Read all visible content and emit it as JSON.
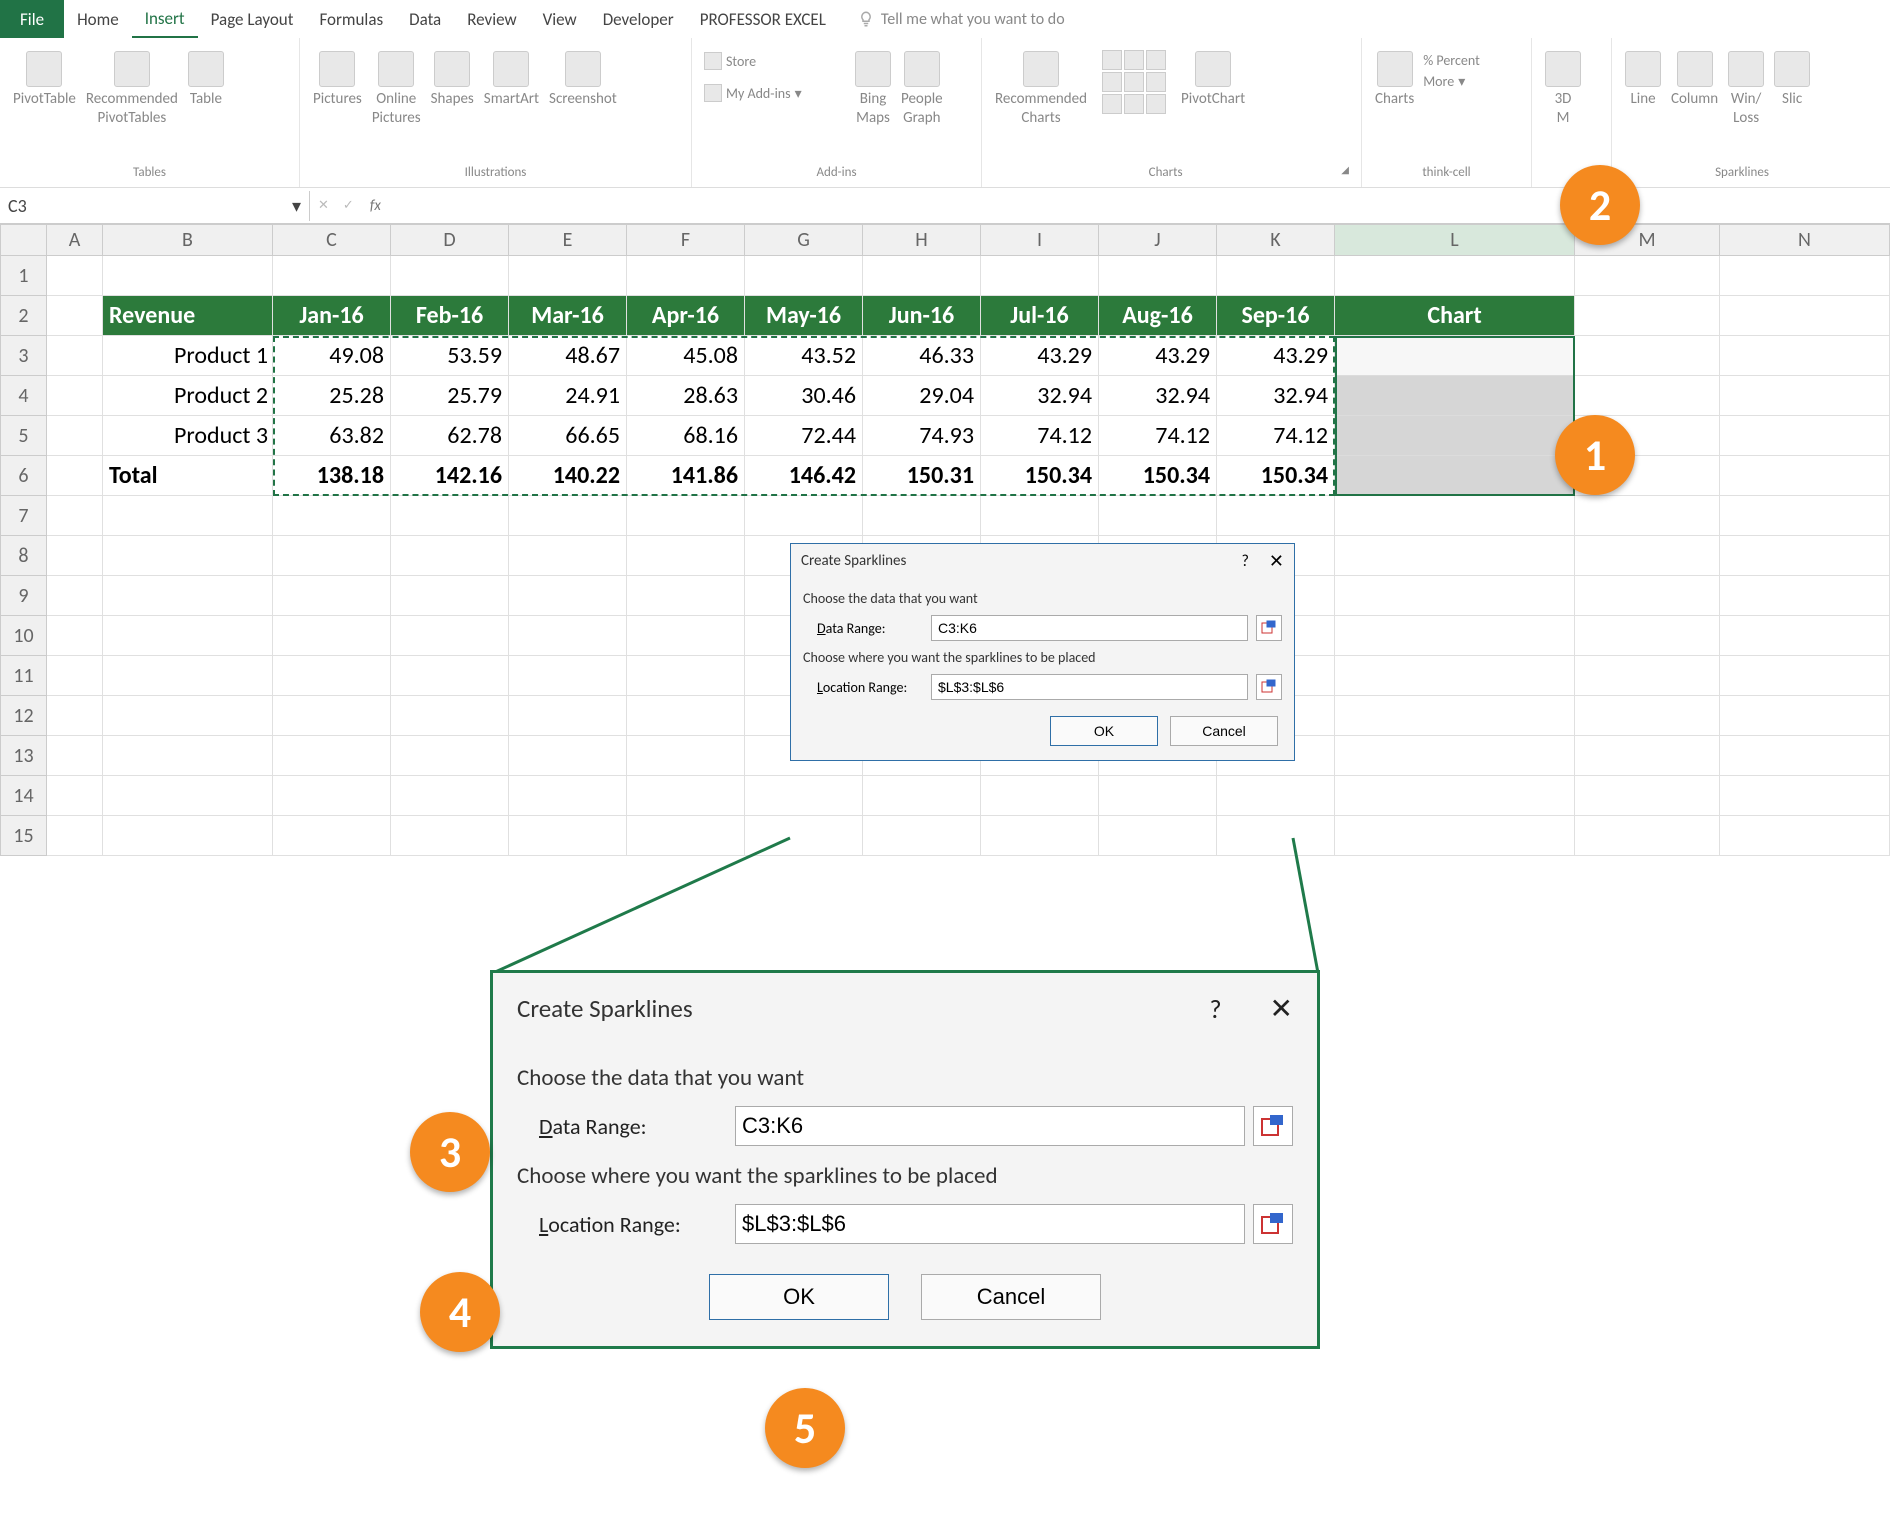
{
  "tabs": {
    "file": "File",
    "home": "Home",
    "insert": "Insert",
    "pageLayout": "Page Layout",
    "formulas": "Formulas",
    "data": "Data",
    "review": "Review",
    "view": "View",
    "developer": "Developer",
    "profExcel": "PROFESSOR EXCEL",
    "tellMe": "Tell me what you want to do"
  },
  "ribbon": {
    "tables": {
      "pivot": "PivotTable",
      "rec": "Recommended\nPivotTables",
      "table": "Table",
      "group": "Tables"
    },
    "illus": {
      "pictures": "Pictures",
      "online": "Online\nPictures",
      "shapes": "Shapes",
      "smartart": "SmartArt",
      "screenshot": "Screenshot",
      "group": "Illustrations"
    },
    "addins": {
      "store": "Store",
      "myaddins": "My Add-ins",
      "bing": "Bing\nMaps",
      "people": "People\nGraph",
      "group": "Add-ins"
    },
    "charts": {
      "rec": "Recommended\nCharts",
      "pivotchart": "PivotChart",
      "group": "Charts"
    },
    "think": {
      "charts": "Charts",
      "percent": "% Percent",
      "more": "More",
      "group": "think-cell"
    },
    "tours": {
      "map": "3D\nM"
    },
    "spark": {
      "line": "Line",
      "column": "Column",
      "winloss": "Win/\nLoss",
      "slic": "Slic",
      "group": "Sparklines"
    }
  },
  "formulaBar": {
    "nameBox": "C3",
    "fx": "fx",
    "value": ""
  },
  "cols": [
    "A",
    "B",
    "C",
    "D",
    "E",
    "F",
    "G",
    "H",
    "I",
    "J",
    "K",
    "L",
    "M",
    "N"
  ],
  "colWidths": {
    "A": 56,
    "B": 170,
    "C": 118,
    "D": 118,
    "E": 118,
    "F": 118,
    "G": 118,
    "H": 118,
    "I": 118,
    "J": 118,
    "K": 118,
    "L": 240,
    "M": 145,
    "N": 170
  },
  "rowNums": [
    "1",
    "2",
    "3",
    "4",
    "5",
    "6",
    "7",
    "8",
    "9",
    "10",
    "11",
    "12",
    "13",
    "14",
    "15"
  ],
  "sheet": {
    "header": [
      "Revenue",
      "Jan-16",
      "Feb-16",
      "Mar-16",
      "Apr-16",
      "May-16",
      "Jun-16",
      "Jul-16",
      "Aug-16",
      "Sep-16",
      "Chart"
    ],
    "rows": [
      {
        "label": "Product 1",
        "vals": [
          "49.08",
          "53.59",
          "48.67",
          "45.08",
          "43.52",
          "46.33",
          "43.29",
          "43.29",
          "43.29"
        ]
      },
      {
        "label": "Product 2",
        "vals": [
          "25.28",
          "25.79",
          "24.91",
          "28.63",
          "30.46",
          "29.04",
          "32.94",
          "32.94",
          "32.94"
        ]
      },
      {
        "label": "Product 3",
        "vals": [
          "63.82",
          "62.78",
          "66.65",
          "68.16",
          "72.44",
          "74.93",
          "74.12",
          "74.12",
          "74.12"
        ]
      }
    ],
    "total": {
      "label": "Total",
      "vals": [
        "138.18",
        "142.16",
        "140.22",
        "141.86",
        "146.42",
        "150.31",
        "150.34",
        "150.34",
        "150.34"
      ]
    }
  },
  "dialog": {
    "title": "Create Sparklines",
    "help": "?",
    "choose1": "Choose the data that you want",
    "dataRange": {
      "label": "Data Range:",
      "value": "C3:K6"
    },
    "choose2": "Choose where you want the sparklines to be placed",
    "locRange": {
      "label": "Location Range:",
      "value": "$L$3:$L$6"
    },
    "ok": "OK",
    "cancel": "Cancel"
  },
  "badges": {
    "b1": "1",
    "b2": "2",
    "b3": "3",
    "b4": "4",
    "b5": "5"
  }
}
